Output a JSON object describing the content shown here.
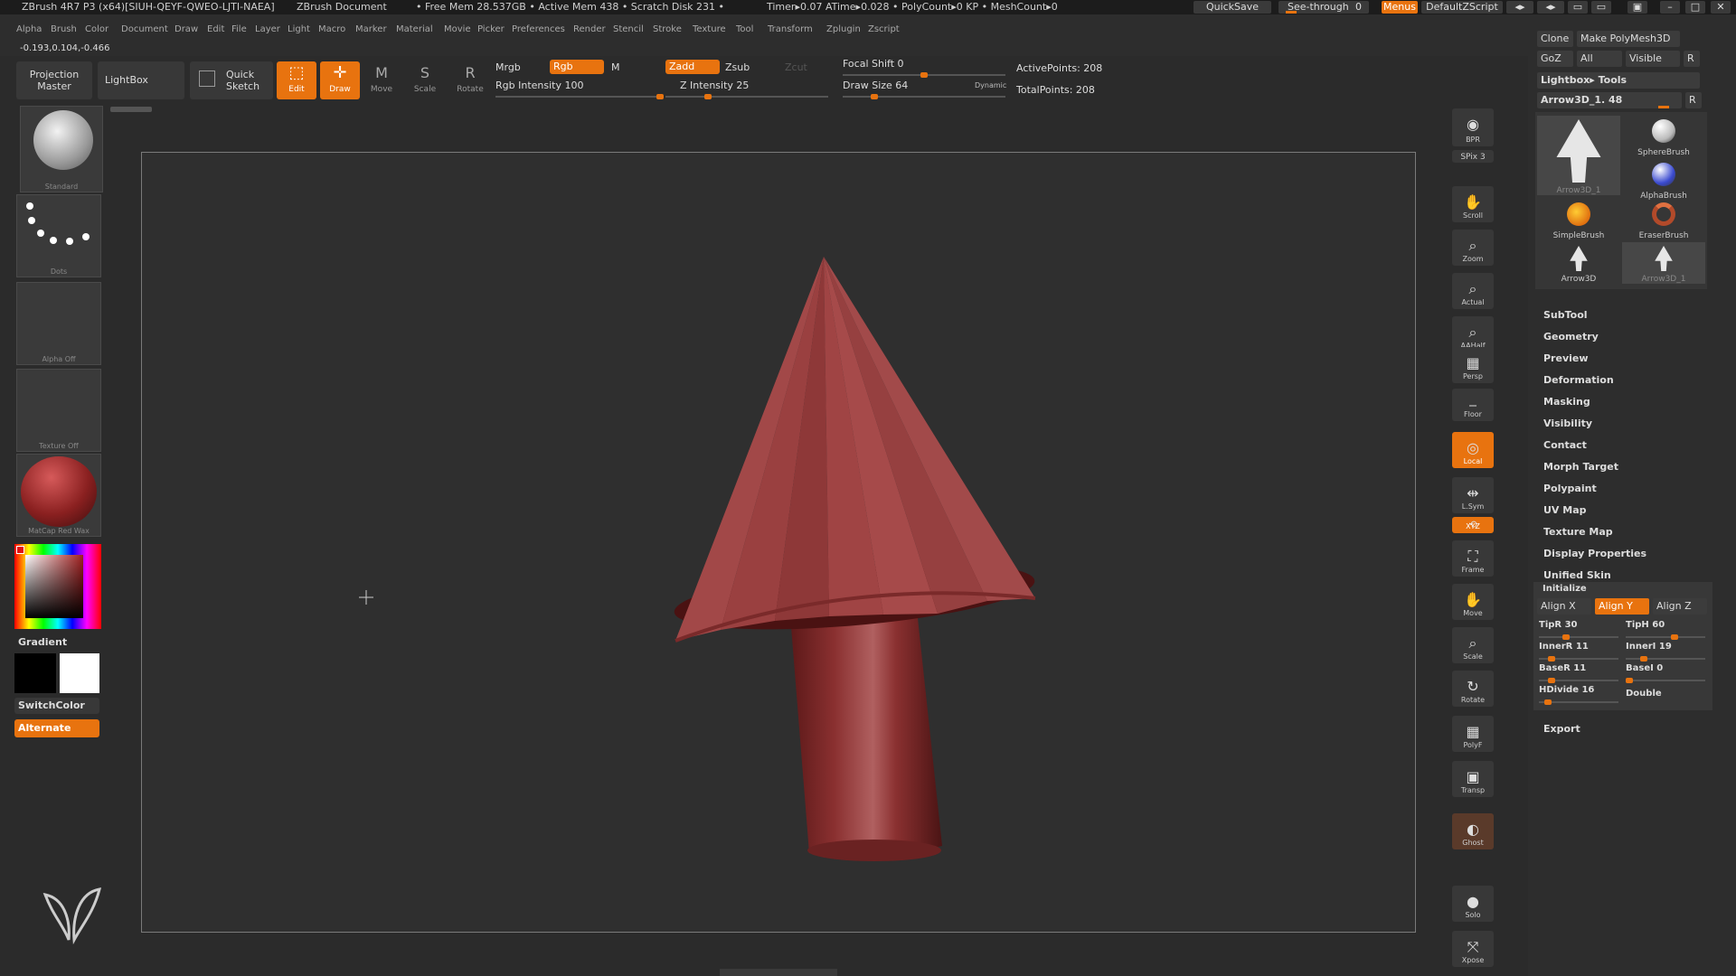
{
  "title_bar": {
    "app": "ZBrush 4R7 P3 (x64)[SIUH-QEYF-QWEO-LJTI-NAEA]",
    "document": "ZBrush Document",
    "stats": "• Free Mem 28.537GB • Active Mem 438 • Scratch Disk 231 •",
    "timers": "Timer▸0.07 ATime▸0.028 • PolyCount▸0 KP • MeshCount▸0",
    "quicksave": "QuickSave",
    "see_through": "See-through",
    "see_through_value": "0",
    "menus": "Menus",
    "script": "DefaultZScript"
  },
  "menu_bar": [
    "Alpha",
    "Brush",
    "Color",
    "Document",
    "Draw",
    "Edit",
    "File",
    "Layer",
    "Light",
    "Macro",
    "Marker",
    "Material",
    "Movie",
    "Picker",
    "Preferences",
    "Render",
    "Stencil",
    "Stroke",
    "Texture",
    "Tool",
    "Transform",
    "Zplugin",
    "Zscript"
  ],
  "coords": "-0.193,0.104,-0.466",
  "toolbar": {
    "projection_master": "Projection Master",
    "lightbox": "LightBox",
    "quick_sketch": "Quick Sketch",
    "edit": "Edit",
    "draw": "Draw",
    "move": "Move",
    "scale": "Scale",
    "rotate": "Rotate",
    "mrgb": "Mrgb",
    "rgb": "Rgb",
    "m": "M",
    "rgb_intensity": "Rgb Intensity 100",
    "zadd": "Zadd",
    "zsub": "Zsub",
    "zcut": "Zcut",
    "z_intensity": "Z Intensity 25",
    "focal_shift": "Focal Shift 0",
    "draw_size": "Draw Size 64",
    "dynamic": "Dynamic",
    "active_points": "ActivePoints: 208",
    "total_points": "TotalPoints: 208",
    "rgb_intensity_level": 1.0,
    "z_intensity_level": 0.25,
    "focal_shift_level": 0.5,
    "draw_size_level": 0.18
  },
  "left_shelf": {
    "brush": "Standard",
    "stroke": "Dots",
    "alpha": "Alpha  Off",
    "texture": "Texture  Off",
    "material": "MatCap Red Wax",
    "gradient": "Gradient",
    "switch_color": "SwitchColor",
    "alternate": "Alternate"
  },
  "right_shelf": [
    {
      "id": "bpr",
      "label": "BPR",
      "icon": "render-icon"
    },
    {
      "id": "spix",
      "label": "SPix 3",
      "icon": ""
    },
    {
      "id": "scroll",
      "label": "Scroll",
      "icon": "hand-icon"
    },
    {
      "id": "zoom",
      "label": "Zoom",
      "icon": "zoom-icon"
    },
    {
      "id": "actual",
      "label": "Actual",
      "icon": "zoom-icon"
    },
    {
      "id": "aahalf",
      "label": "AAHalf",
      "icon": "zoom-icon"
    },
    {
      "id": "persp",
      "label": "Persp",
      "icon": "grid-icon"
    },
    {
      "id": "floor",
      "label": "Floor",
      "icon": "floor-icon"
    },
    {
      "id": "local",
      "label": "Local",
      "icon": "local-icon"
    },
    {
      "id": "lsym",
      "label": "L.Sym",
      "icon": "symmetry-icon"
    },
    {
      "id": "xyz",
      "label": "XYZ",
      "icon": "axis-icon"
    },
    {
      "id": "frame",
      "label": "Frame",
      "icon": "frame-icon"
    },
    {
      "id": "move",
      "label": "Move",
      "icon": "hand-icon"
    },
    {
      "id": "scale",
      "label": "Scale",
      "icon": "zoom-icon"
    },
    {
      "id": "rotate",
      "label": "Rotate",
      "icon": "rotate-icon"
    },
    {
      "id": "polyf",
      "label": "PolyF",
      "icon": "grid-icon"
    },
    {
      "id": "transp",
      "label": "Transp",
      "icon": "transp-icon"
    },
    {
      "id": "ghost",
      "label": "Ghost",
      "icon": "ghost-icon"
    },
    {
      "id": "solo",
      "label": "Solo",
      "icon": "solo-icon"
    },
    {
      "id": "xpose",
      "label": "Xpose",
      "icon": "xpose-icon"
    }
  ],
  "right_panel": {
    "clone": "Clone",
    "make_polymesh": "Make PolyMesh3D",
    "goz": "GoZ",
    "all": "All",
    "visible": "Visible",
    "r": "R",
    "lightbox_tools": "Lightbox▸ Tools",
    "current_tool": "Arrow3D_1. 48",
    "tools": [
      {
        "label": "Arrow3D_1",
        "icon": "arrow-icon"
      },
      {
        "label": "SphereBrush",
        "icon": "sphere-icon"
      },
      {
        "label": "AlphaBrush",
        "icon": "sphere-icon"
      },
      {
        "label": "SimpleBrush",
        "icon": "simple-icon"
      },
      {
        "label": "EraserBrush",
        "icon": "eraser-icon"
      },
      {
        "label": "Arrow3D",
        "icon": "arrow-icon"
      },
      {
        "label": "Arrow3D_1",
        "icon": "arrow-icon"
      }
    ],
    "menu_items": [
      "SubTool",
      "Geometry",
      "Preview",
      "Deformation",
      "Masking",
      "Visibility",
      "Contact",
      "Morph Target",
      "Polypaint",
      "UV Map",
      "Texture Map",
      "Display Properties",
      "Unified Skin"
    ],
    "initialize": {
      "title": "Initialize",
      "align_x": "Align X",
      "align_y": "Align Y",
      "align_z": "Align Z",
      "tipr": "TipR 30",
      "tiph": "TipH 60",
      "innerr": "InnerR 11",
      "inneri": "InnerI 19",
      "baser": "BaseR 11",
      "basei": "BaseI 0",
      "hdivide": "HDivide 16",
      "double": "Double"
    },
    "export": "Export"
  },
  "colors": {
    "accent": "#e8730f",
    "background": "#2b2b2b",
    "panel": "#383838",
    "model": "#8a3030"
  }
}
